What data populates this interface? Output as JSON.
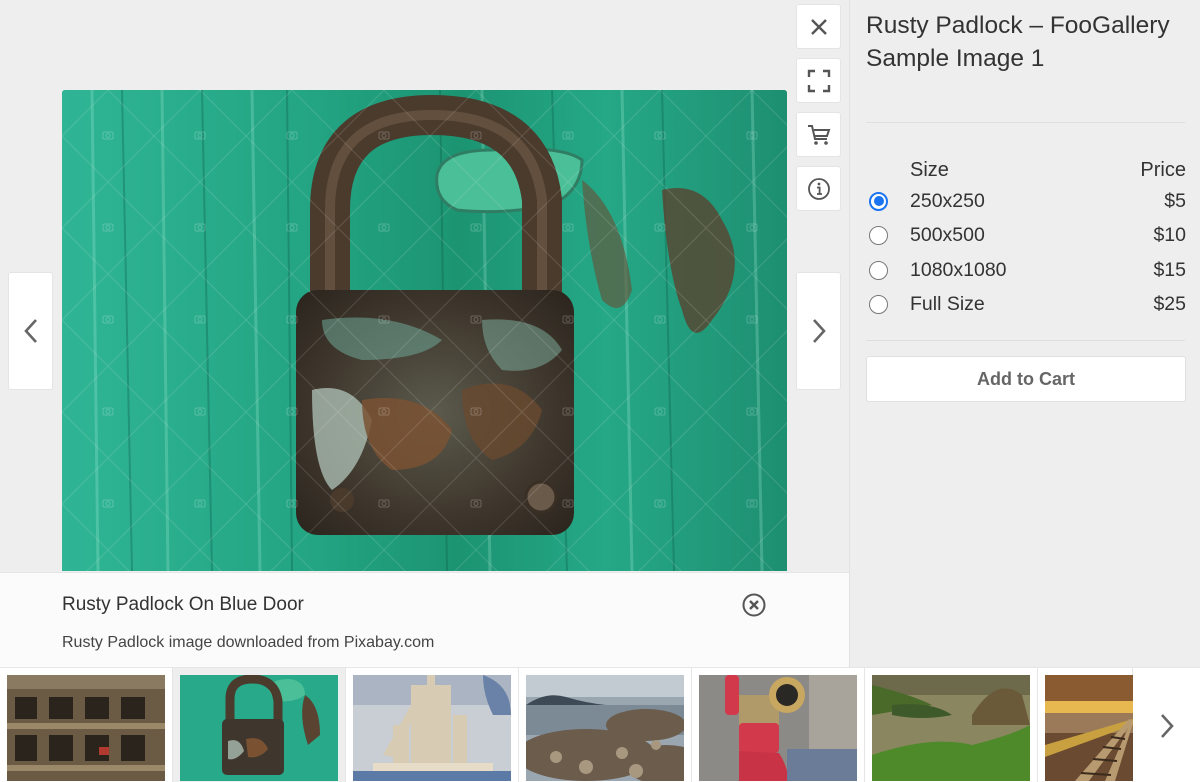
{
  "lightbox": {
    "main_image": {
      "subject": "rusty padlock on green door",
      "alt": "Rusty Padlock On Blue Door",
      "colors": {
        "door": "#27a98a",
        "door_light": "#4cc7a8",
        "lock_dark": "#3a3128",
        "lock_rust": "#6d4a2e",
        "lock_paint": "#8fb8a6"
      }
    },
    "toolbar": {
      "close_icon": "close-icon",
      "fullscreen_icon": "fullscreen-icon",
      "cart_icon": "cart-icon",
      "info_icon": "info-icon"
    },
    "nav": {
      "prev_icon": "chevron-left-icon",
      "next_icon": "chevron-right-icon"
    },
    "caption": {
      "title": "Rusty Padlock On Blue Door",
      "description": "Rusty Padlock image downloaded from Pixabay.com",
      "close_icon": "circle-x-icon"
    },
    "panel": {
      "title": "Rusty Padlock – FooGallery Sample Image 1",
      "table": {
        "headers": {
          "size": "Size",
          "price": "Price"
        },
        "rows": [
          {
            "size": "250x250",
            "price": "$5",
            "selected": true
          },
          {
            "size": "500x500",
            "price": "$10",
            "selected": false
          },
          {
            "size": "1080x1080",
            "price": "$15",
            "selected": false
          },
          {
            "size": "Full Size",
            "price": "$25",
            "selected": false
          }
        ]
      },
      "add_to_cart_label": "Add to Cart"
    },
    "thumbnails": {
      "items": [
        {
          "subject": "abandoned building with graffiti",
          "active": false
        },
        {
          "subject": "rusty padlock on green door",
          "active": true
        },
        {
          "subject": "sand castle",
          "active": false
        },
        {
          "subject": "rocky shoreline",
          "active": false
        },
        {
          "subject": "red fire hydrant pipe",
          "active": false
        },
        {
          "subject": "mossy landscape",
          "active": false
        },
        {
          "subject": "railway tracks at sunset",
          "active": false
        }
      ],
      "next_icon": "chevron-right-icon"
    },
    "accent_color": "#1a73f0"
  }
}
